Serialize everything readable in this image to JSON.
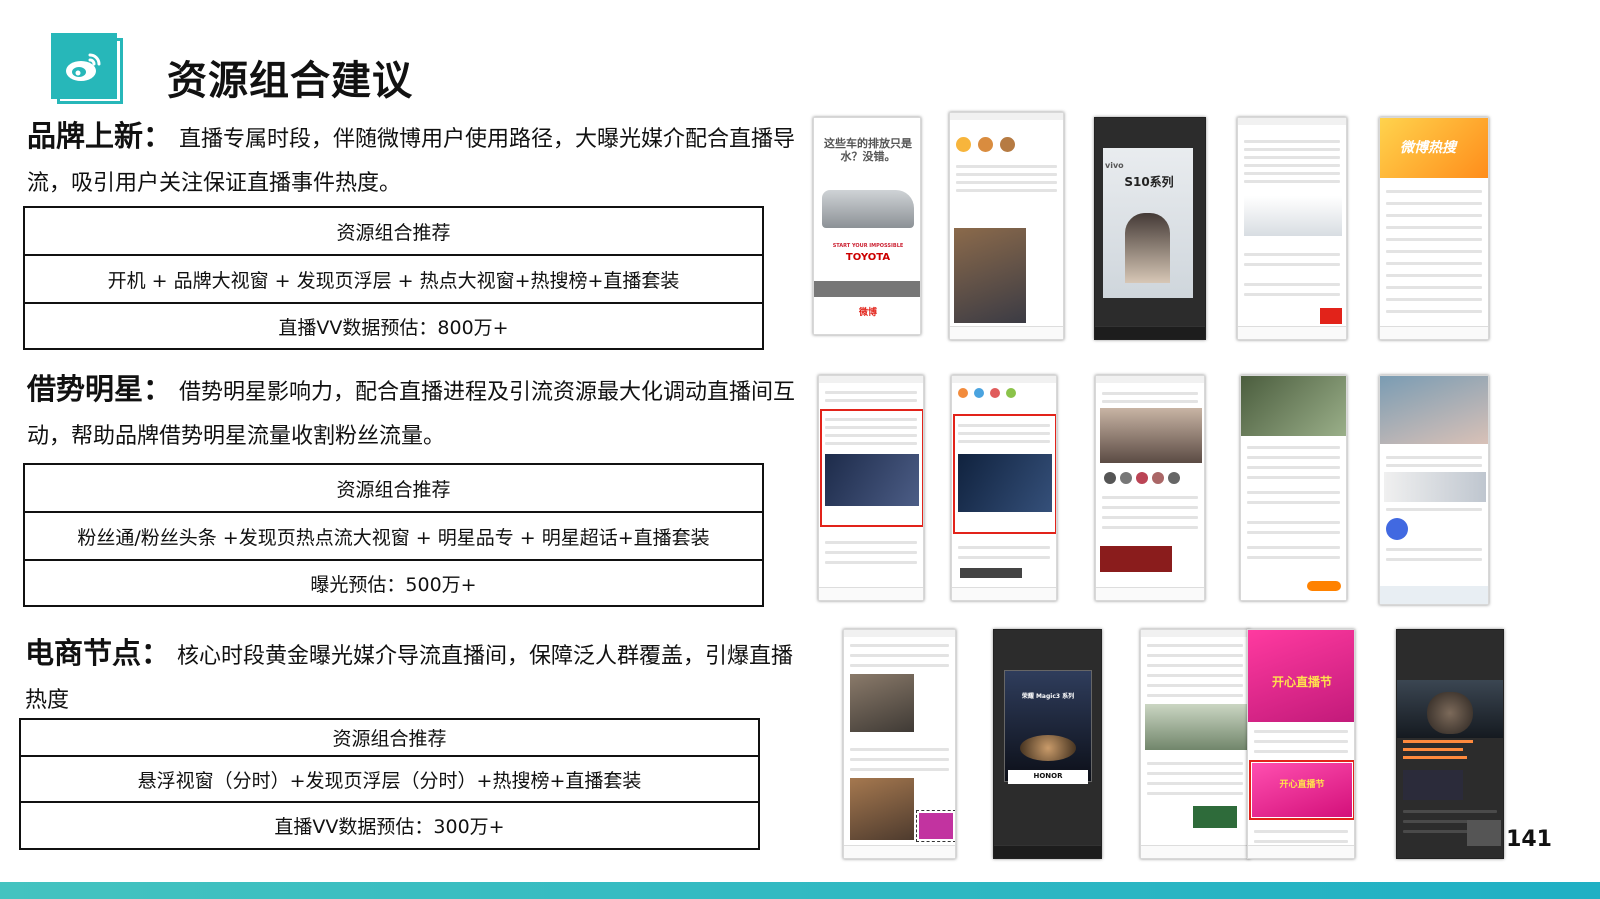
{
  "title": "资源组合建议",
  "sections": [
    {
      "head": "品牌上新：",
      "body": "直播专属时段，伴随微博用户使用路径，大曝光媒介配合直播导流，吸引用户关注保证直播事件热度。",
      "table": {
        "header": "资源组合推荐",
        "resources": "开机 + 品牌大视窗 + 发现页浮层 + 热点大视窗+热搜榜+直播套装",
        "estimate": "直播VV数据预估：800万+"
      }
    },
    {
      "head": "借势明星：",
      "body": "借势明星影响力，配合直播进程及引流资源最大化调动直播间互动，帮助品牌借势明星流量收割粉丝流量。",
      "table": {
        "header": "资源组合推荐",
        "resources": "粉丝通/粉丝头条 +发现页热点流大视窗 + 明星品专 + 明星超话+直播套装",
        "estimate": "曝光预估：500万+"
      }
    },
    {
      "head": "电商节点：",
      "body": "核心时段黄金曝光媒介导流直播间，保障泛人群覆盖，引爆直播热度",
      "table": {
        "header": "资源组合推荐",
        "resources": "悬浮视窗（分时）+发现页浮层（分时）+热搜榜+直播套装",
        "estimate": "直播VV数据预估：300万+"
      }
    }
  ],
  "screenshots": {
    "splash_text": "这些车的排放只是水？没错。",
    "splash_slogan": "START YOUR IMPOSSIBLE",
    "splash_brand": "TOYOTA",
    "splash_footer": "微博",
    "vivo_brand": "vivo",
    "vivo_model": "S10系列",
    "hotsearch_banner": "微博热搜",
    "honor_model": "荣耀 Magic3 系列",
    "honor_brand": "HONOR",
    "suning_banner": "开心直播节",
    "suning_sub": "开心直播节"
  },
  "page_number": "141",
  "colors": {
    "accent": "#27b7b9",
    "highlight": "#e2231a",
    "weibo_orange": "#ff8200"
  }
}
